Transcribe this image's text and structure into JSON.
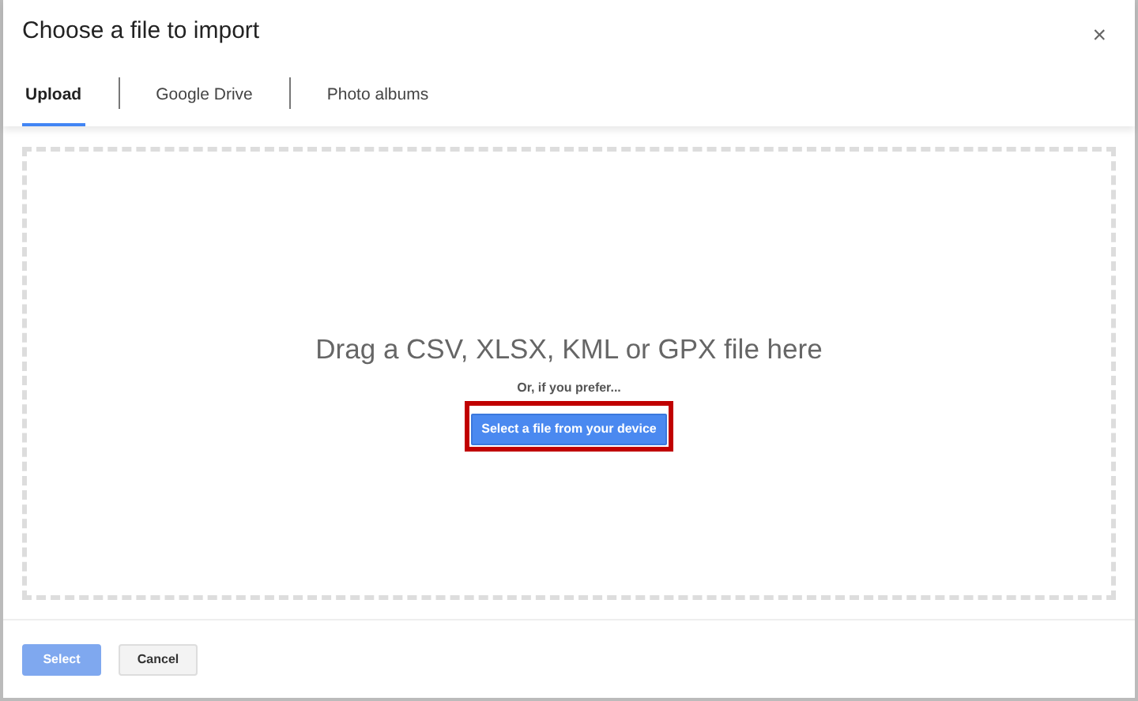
{
  "dialog": {
    "title": "Choose a file to import",
    "close": "×"
  },
  "tabs": [
    {
      "label": "Upload",
      "selected": true
    },
    {
      "label": "Google Drive",
      "selected": false
    },
    {
      "label": "Photo albums",
      "selected": false
    }
  ],
  "drop_zone": {
    "heading": "Drag a CSV, XLSX, KML or GPX file here",
    "hint": "Or, if you prefer...",
    "button": "Select a file from your device",
    "highlighted": true
  },
  "footer": {
    "buttons": [
      {
        "label": "Select",
        "kind": "primary",
        "disabled": true
      },
      {
        "label": "Cancel",
        "kind": "secondary",
        "disabled": false
      }
    ]
  }
}
